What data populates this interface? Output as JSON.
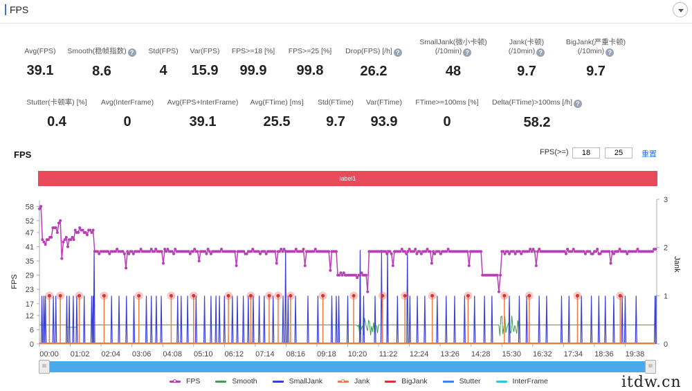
{
  "header": {
    "title": "FPS"
  },
  "metrics_row1": [
    {
      "label": "Avg(FPS)",
      "value": "39.1",
      "help": false
    },
    {
      "label": "Smooth(稳帧指数)",
      "value": "8.6",
      "help": true
    },
    {
      "label": "Std(FPS)",
      "value": "4",
      "help": false
    },
    {
      "label": "Var(FPS)",
      "value": "15.9",
      "help": false
    },
    {
      "label": "FPS>=18 [%]",
      "value": "99.9",
      "help": false
    },
    {
      "label": "FPS>=25 [%]",
      "value": "99.8",
      "help": false
    },
    {
      "label": "Drop(FPS) [/h]",
      "value": "26.2",
      "help": true
    },
    {
      "label": "SmallJank(微小卡顿)",
      "label2": "(/10min)",
      "value": "48",
      "help": true
    },
    {
      "label": "Jank(卡顿)",
      "label2": "(/10min)",
      "value": "9.7",
      "help": true
    },
    {
      "label": "BigJank(严重卡顿)",
      "label2": "(/10min)",
      "value": "9.7",
      "help": true
    }
  ],
  "metrics_row2": [
    {
      "label": "Stutter(卡顿率) [%]",
      "value": "0.4",
      "help": false
    },
    {
      "label": "Avg(InterFrame)",
      "value": "0",
      "help": false
    },
    {
      "label": "Avg(FPS+InterFrame)",
      "value": "39.1",
      "help": false
    },
    {
      "label": "Avg(FTime) [ms]",
      "value": "25.5",
      "help": false
    },
    {
      "label": "Std(FTime)",
      "value": "9.7",
      "help": false
    },
    {
      "label": "Var(FTime)",
      "value": "93.9",
      "help": false
    },
    {
      "label": "FTime>=100ms [%]",
      "value": "0",
      "help": false
    },
    {
      "label": "Delta(FTime)>100ms [/h]",
      "value": "58.2",
      "help": true
    }
  ],
  "chart_section": {
    "title": "FPS",
    "filter_label": "FPS(>=)",
    "filter_low": "18",
    "filter_high": "25",
    "reset_label": "重置",
    "label_bar": "label1"
  },
  "slider": {
    "start_fraction": 0,
    "end_fraction": 1,
    "handle_glyph": "III"
  },
  "watermark": "itdw.cn",
  "chart_data": {
    "type": "line",
    "title": "FPS",
    "ylabel": "FPS",
    "ylabel_right": "Jank",
    "ylim": [
      0,
      61
    ],
    "ylim_right": [
      0,
      3
    ],
    "yticks": [
      "0",
      "6",
      "12",
      "17",
      "23",
      "29",
      "35",
      "41",
      "47",
      "52",
      "58"
    ],
    "yticks_right": [
      "0",
      "1",
      "2",
      "3"
    ],
    "xticks": [
      "00:00",
      "01:02",
      "02:04",
      "03:06",
      "04:08",
      "05:10",
      "06:12",
      "07:14",
      "08:16",
      "09:18",
      "10:20",
      "11:22",
      "12:24",
      "13:26",
      "14:28",
      "15:30",
      "16:32",
      "17:34",
      "18:36",
      "19:38"
    ],
    "x_range_seconds": [
      0,
      1240
    ],
    "legend": [
      "FPS",
      "Smooth",
      "SmallJank",
      "Jank",
      "BigJank",
      "Stutter",
      "InterFrame"
    ],
    "legend_position": "bottom",
    "colors": {
      "FPS": "#b93db5",
      "Smooth": "#3aa04a",
      "SmallJank": "#3a3fd8",
      "Jank": "#f07a3a",
      "BigJank": "#d93232",
      "Stutter": "#3f84e8",
      "InterFrame": "#2ec7d8"
    },
    "fps_segments": [
      {
        "from": 0,
        "to": 5,
        "fps": 57
      },
      {
        "from": 5,
        "to": 25,
        "fps": 44
      },
      {
        "from": 25,
        "to": 45,
        "fps": 49
      },
      {
        "from": 45,
        "to": 70,
        "fps": 44
      },
      {
        "from": 70,
        "to": 110,
        "fps": 48
      },
      {
        "from": 110,
        "to": 600,
        "fps": 39
      },
      {
        "from": 600,
        "to": 660,
        "fps": 29
      },
      {
        "from": 660,
        "to": 890,
        "fps": 39
      },
      {
        "from": 890,
        "to": 930,
        "fps": 29
      },
      {
        "from": 930,
        "to": 1240,
        "fps": 39
      }
    ],
    "fps_dips": [
      {
        "t": 45,
        "fps": 36
      },
      {
        "t": 175,
        "fps": 32
      },
      {
        "t": 248,
        "fps": 34
      },
      {
        "t": 320,
        "fps": 35
      },
      {
        "t": 395,
        "fps": 33
      },
      {
        "t": 478,
        "fps": 34
      },
      {
        "t": 535,
        "fps": 33
      },
      {
        "t": 585,
        "fps": 31
      },
      {
        "t": 660,
        "fps": 22
      },
      {
        "t": 710,
        "fps": 33
      },
      {
        "t": 790,
        "fps": 34
      },
      {
        "t": 865,
        "fps": 33
      },
      {
        "t": 925,
        "fps": 22
      },
      {
        "t": 1000,
        "fps": 33
      },
      {
        "t": 1150,
        "fps": 34
      }
    ],
    "smooth_value": 8,
    "smooth_noisy_ranges": [
      [
        640,
        680
      ],
      [
        925,
        965
      ]
    ],
    "jank_events_seconds": [
      20,
      42,
      80,
      130,
      200,
      265,
      310,
      380,
      425,
      462,
      480,
      505,
      570,
      632,
      690,
      735,
      790,
      862,
      935,
      985,
      1082,
      1168
    ],
    "smalljank_events_seconds": [
      5,
      9,
      12,
      28,
      33,
      55,
      60,
      68,
      75,
      90,
      105,
      108,
      145,
      160,
      175,
      190,
      215,
      225,
      235,
      245,
      278,
      285,
      298,
      315,
      332,
      345,
      355,
      362,
      372,
      388,
      398,
      410,
      420,
      430,
      442,
      452,
      470,
      490,
      500,
      515,
      540,
      560,
      588,
      597,
      602,
      620,
      645,
      652,
      675,
      700,
      720,
      745,
      760,
      775,
      800,
      818,
      835,
      855,
      875,
      895,
      910,
      945,
      965,
      980,
      1005,
      1020,
      1050,
      1065,
      1090,
      1110,
      1125,
      1138,
      1155,
      1172,
      1178,
      1200,
      1238
    ],
    "smalljank_tall_seconds": [
      110,
      495,
      645,
      688,
      700,
      740
    ]
  }
}
